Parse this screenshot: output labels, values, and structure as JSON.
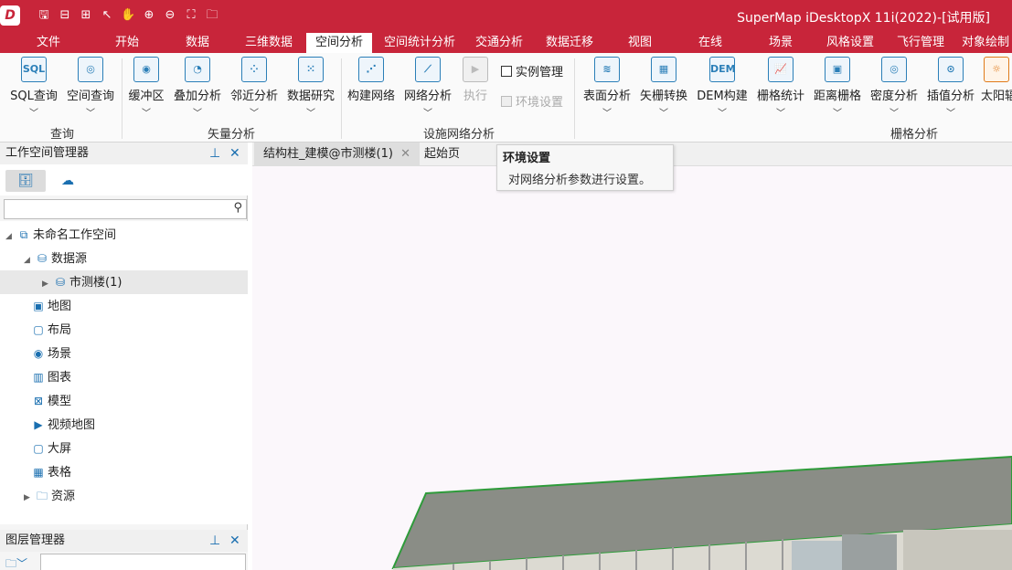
{
  "titlebar": {
    "title": "SuperMap iDesktopX 11i(2022)-[试用版]",
    "logo_text": "D"
  },
  "quick_access": [
    "save-icon",
    "open-icon",
    "export-icon",
    "select-icon",
    "pan-icon",
    "zoom-in-icon",
    "zoom-out-icon",
    "fullextent-icon",
    "folder-icon"
  ],
  "menu": {
    "items": [
      "文件",
      "开始",
      "数据",
      "三维数据",
      "空间分析",
      "空间统计分析",
      "交通分析",
      "数据迁移",
      "视图",
      "在线",
      "场景",
      "风格设置",
      "飞行管理",
      "对象绘制"
    ],
    "active": "空间分析"
  },
  "ribbon": {
    "buttons": [
      "SQL查询",
      "空间查询",
      "缓冲区",
      "叠加分析",
      "邻近分析",
      "数据研究",
      "构建网络",
      "网络分析",
      "执行",
      "表面分析",
      "矢栅转换",
      "DEM构建",
      "栅格统计",
      "距离栅格",
      "密度分析",
      "插值分析",
      "太阳辐"
    ],
    "icons": {
      "sql": "SQL",
      "dem": "DEM"
    },
    "checkboxes": [
      "实例管理",
      "环境设置"
    ],
    "groups": [
      "查询",
      "矢量分析",
      "设施网络分析",
      "栅格分析"
    ]
  },
  "workspace_manager": {
    "title": "工作空间管理器",
    "search_placeholder": "",
    "tree": [
      "未命名工作空间",
      "数据源",
      "市测楼(1)",
      "地图",
      "布局",
      "场景",
      "图表",
      "模型",
      "视频地图",
      "大屏",
      "表格",
      "资源"
    ]
  },
  "layer_manager": {
    "title": "图层管理器"
  },
  "document_tabs": [
    "结构柱_建模@市测楼(1)",
    "起始页"
  ],
  "tooltip": {
    "title": "环境设置",
    "description": "对网络分析参数进行设置。"
  },
  "colors": {
    "brand": "#c8253a",
    "roof": "#8a8d86",
    "edge": "#2e9b3a"
  }
}
